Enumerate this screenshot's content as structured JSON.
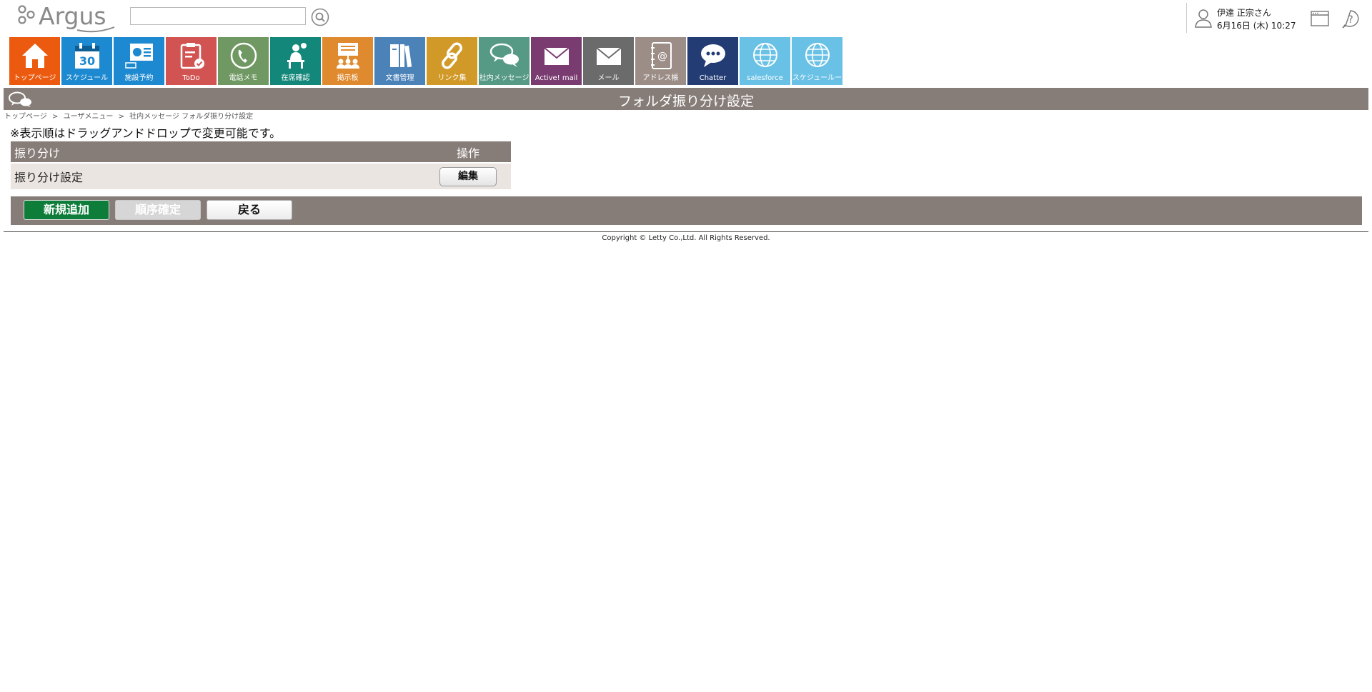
{
  "header": {
    "logo_text": "Argus",
    "search_placeholder": "",
    "user_name": "伊達 正宗さん",
    "user_datetime": "6月16日 (木) 10:27"
  },
  "tiles": [
    {
      "label": "トップページ",
      "color": "#ec5a0f",
      "icon": "home-icon"
    },
    {
      "label": "スケジュール",
      "color": "#1c89d0",
      "icon": "calendar-icon"
    },
    {
      "label": "施設予約",
      "color": "#1c89d0",
      "icon": "facility-icon"
    },
    {
      "label": "ToDo",
      "color": "#d25452",
      "icon": "clipboard-check-icon"
    },
    {
      "label": "電話メモ",
      "color": "#6f9862",
      "icon": "phone-icon"
    },
    {
      "label": "在席確認",
      "color": "#13877a",
      "icon": "presence-icon"
    },
    {
      "label": "掲示板",
      "color": "#e08a2f",
      "icon": "board-icon"
    },
    {
      "label": "文書管理",
      "color": "#4b82b8",
      "icon": "documents-icon"
    },
    {
      "label": "リンク集",
      "color": "#d19a28",
      "icon": "link-icon"
    },
    {
      "label": "社内メッセージ",
      "color": "#569a85",
      "icon": "chat-bubbles-icon"
    },
    {
      "label": "Active! mail",
      "color": "#7a3b71",
      "icon": "envelope-icon"
    },
    {
      "label": "メール",
      "color": "#6b6b6b",
      "icon": "envelope-icon"
    },
    {
      "label": "アドレス帳",
      "color": "#9c8e87",
      "icon": "address-book-icon"
    },
    {
      "label": "Chatter",
      "color": "#233c73",
      "icon": "chatter-icon"
    },
    {
      "label": "salesforce",
      "color": "#6ac1e6",
      "icon": "globe-icon"
    },
    {
      "label": "スケジュールー",
      "color": "#6ac1e6",
      "icon": "globe-icon"
    }
  ],
  "page": {
    "title": "フォルダ振り分け設定",
    "breadcrumb": [
      "トップページ",
      "ユーザメニュー",
      "社内メッセージ フォルダ振り分け設定"
    ],
    "breadcrumb_sep": ">",
    "note": "※表示順はドラッグアンドドロップで変更可能です。"
  },
  "table": {
    "headers": {
      "name": "振り分け",
      "ops": "操作"
    },
    "rows": [
      {
        "name": "振り分け設定",
        "action": "編集"
      }
    ]
  },
  "actions": {
    "add": "新規追加",
    "order": "順序確定",
    "back": "戻る"
  },
  "footer": {
    "copyright": "Copyright © Letty Co.,Ltd. All Rights Reserved."
  }
}
